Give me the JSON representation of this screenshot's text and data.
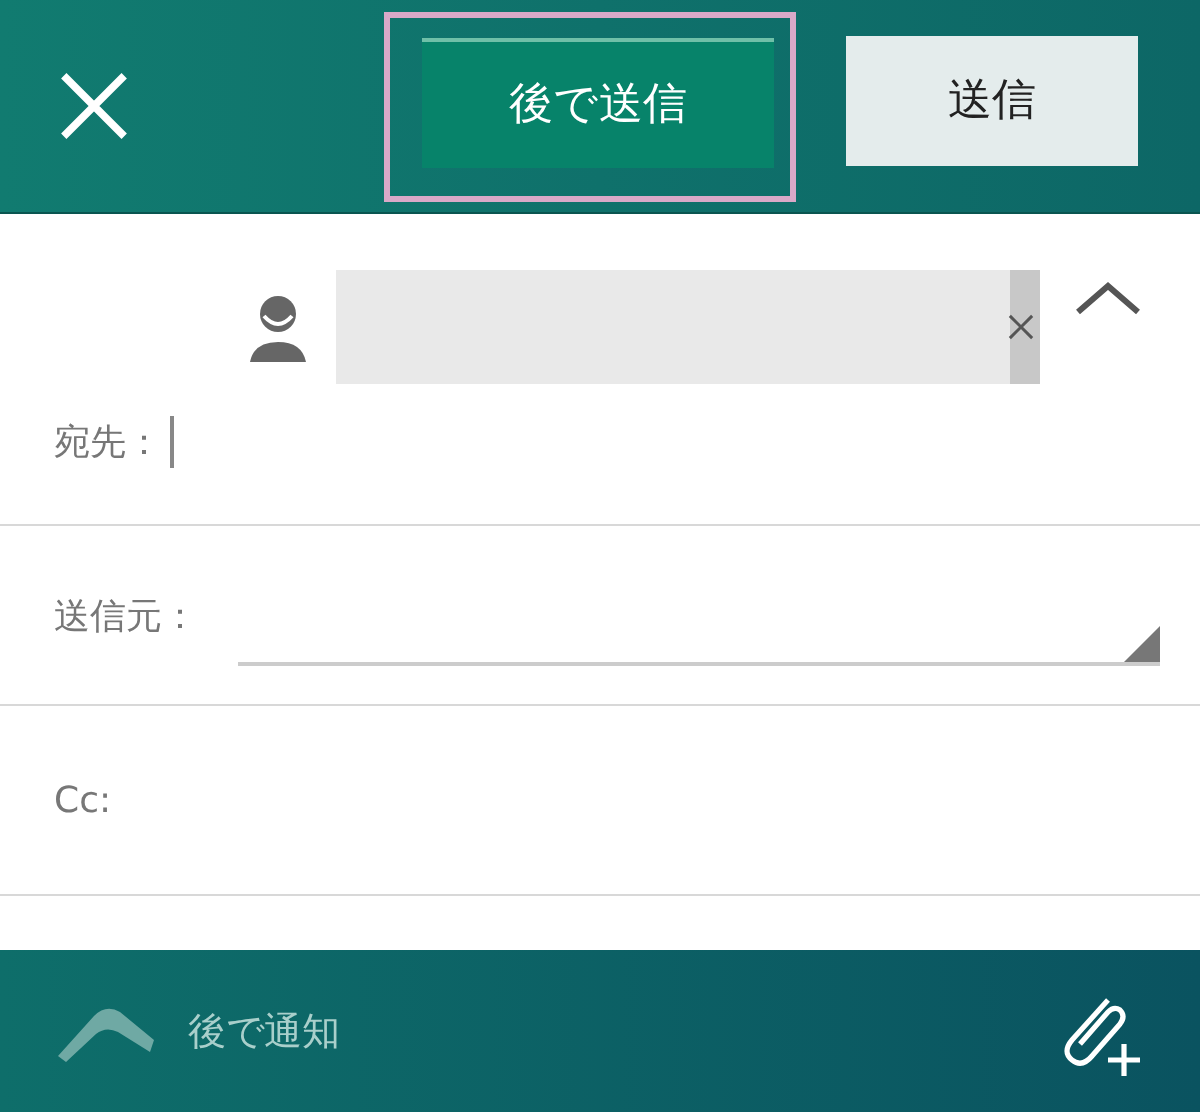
{
  "toolbar": {
    "buttons": [
      {
        "label": "後で送信",
        "kind": "later",
        "focused": true
      },
      {
        "label": "送信",
        "kind": "send",
        "focused": false
      }
    ]
  },
  "recipients": {
    "expanded": true,
    "chips": [
      {
        "kind": "contact"
      }
    ]
  },
  "fields": [
    {
      "label": "宛先：",
      "kind": "to"
    },
    {
      "label": "送信元：",
      "kind": "dropdown"
    },
    {
      "label": "Cc:",
      "kind": "text"
    }
  ],
  "footer": {
    "remind_label": "後で通知"
  }
}
